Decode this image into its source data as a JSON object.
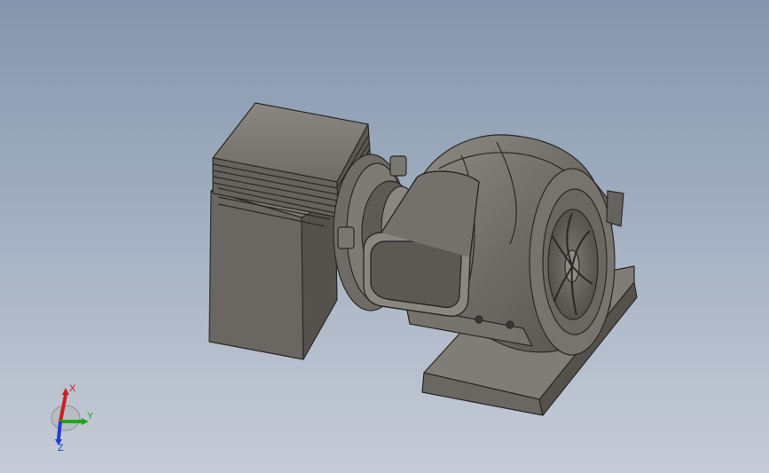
{
  "viewport": {
    "background_top": "#8496ad",
    "background_bottom": "#c6ccd7"
  },
  "model": {
    "name": "blower-motor-assembly",
    "body_color": "#6e6b66",
    "edge_color": "#2a2826"
  },
  "triad": {
    "x_label": "X",
    "y_label": "Y",
    "z_label": "Z",
    "x_color": "#cc2020",
    "y_color": "#1fa51f",
    "z_color": "#1f3fcc"
  }
}
